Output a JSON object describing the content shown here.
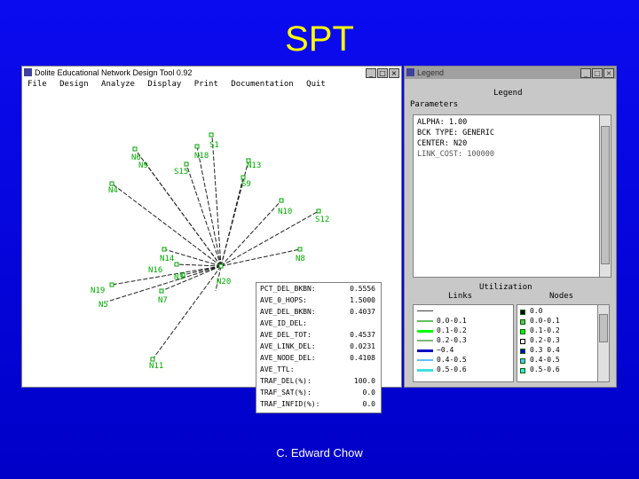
{
  "slide": {
    "title": "SPT",
    "footer": "C. Edward Chow"
  },
  "main_window": {
    "title": "Dolite Educational Network Design Tool 0.92",
    "menu": [
      "File",
      "Design",
      "Analyze",
      "Display",
      "Print",
      "Documentation",
      "Quit"
    ],
    "controls": [
      "_",
      "□",
      "×"
    ],
    "nodes": [
      {
        "id": "S1",
        "label": "S1"
      },
      {
        "id": "N6",
        "label": "N6"
      },
      {
        "id": "N9",
        "label": "N9"
      },
      {
        "id": "N18",
        "label": "N18"
      },
      {
        "id": "S15",
        "label": "S15"
      },
      {
        "id": "N13",
        "label": "N13"
      },
      {
        "id": "N4",
        "label": "N4"
      },
      {
        "id": "S9",
        "label": "S9"
      },
      {
        "id": "N10",
        "label": "N10"
      },
      {
        "id": "S12",
        "label": "S12"
      },
      {
        "id": "N8",
        "label": "N8"
      },
      {
        "id": "N14",
        "label": "N14"
      },
      {
        "id": "N16",
        "label": "N16"
      },
      {
        "id": "N3",
        "label": "N3"
      },
      {
        "id": "N20",
        "label": "N20"
      },
      {
        "id": "N19",
        "label": "N19"
      },
      {
        "id": "N5",
        "label": "N5"
      },
      {
        "id": "N7",
        "label": "N7"
      },
      {
        "id": "N11",
        "label": "N11"
      }
    ],
    "stats": [
      {
        "label": "PCT_DEL_BKBN:",
        "value": "0.5556"
      },
      {
        "label": "AVE_0_HOPS:",
        "value": "1.5000"
      },
      {
        "label": "AVE_DEL_BKBN:",
        "value": "0.4037"
      },
      {
        "label": "AVE_ID_DEL:",
        "value": ""
      },
      {
        "label": "AVE_DEL_TOT:",
        "value": "0.4537"
      },
      {
        "label": "AVE_LINK_DEL:",
        "value": "0.0231"
      },
      {
        "label": "AVE_NODE_DEL:",
        "value": "0.4108"
      },
      {
        "label": "AVE_TTL:",
        "value": ""
      },
      {
        "label": "TRAF_DEL(%):",
        "value": "100.0"
      },
      {
        "label": "TRAF_SAT(%):",
        "value": "0.0"
      },
      {
        "label": "TRAF_INFID(%):",
        "value": "0.0"
      }
    ]
  },
  "legend_window": {
    "title": "Legend",
    "heading": "Legend",
    "parameters_label": "Parameters",
    "parameters": [
      "ALPHA: 1.00",
      "BCK TYPE: GENERIC",
      "CENTER: N20",
      "LINK_COST: 100000"
    ],
    "utilization_label": "Utilization",
    "links_label": "Links",
    "nodes_label": "Nodes",
    "links": [
      {
        "label": "",
        "color": "#404040"
      },
      {
        "label": "0.0-0.1",
        "color": "#60c060"
      },
      {
        "label": "0.1-0.2",
        "color": "#00ff00"
      },
      {
        "label": "0.2-0.3",
        "color": "#7ab87a"
      },
      {
        "label": "~0.4",
        "color": "#0000c0"
      },
      {
        "label": "0.4-0.5",
        "color": "#60c0ff"
      },
      {
        "label": "0.5-0.6",
        "color": "#40e0e0"
      }
    ],
    "node_levels": [
      "0.0",
      "0.0-0.1",
      "0.1-0.2",
      "0.2-0.3",
      "0.3 0.4",
      "0.4-0.5",
      "0.5-0.6"
    ]
  }
}
